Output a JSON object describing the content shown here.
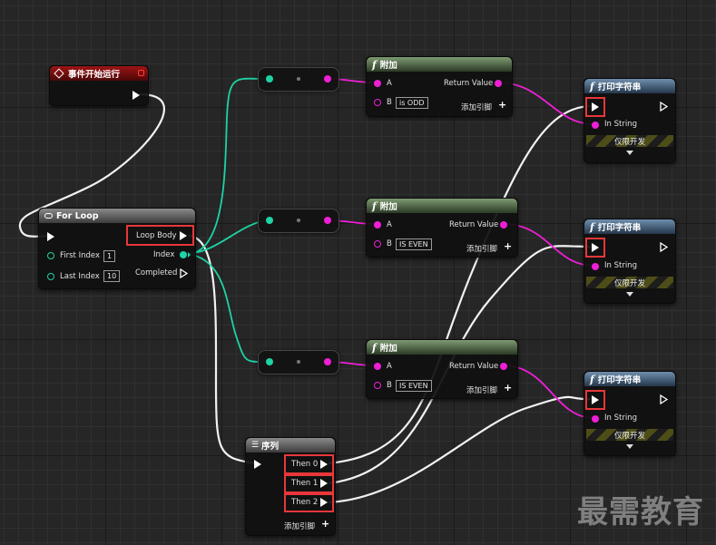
{
  "event_node": {
    "title": "事件开始运行"
  },
  "for_loop": {
    "title": "For Loop",
    "first_index_label": "First Index",
    "first_index_value": "1",
    "last_index_label": "Last Index",
    "last_index_value": "10",
    "loop_body_label": "Loop Body",
    "index_label": "Index",
    "completed_label": "Completed"
  },
  "append_nodes": [
    {
      "title": "附加",
      "a_label": "A",
      "b_label": "B",
      "b_value": "is ODD",
      "return_label": "Return Value",
      "add_pin_label": "添加引脚"
    },
    {
      "title": "附加",
      "a_label": "A",
      "b_label": "B",
      "b_value": "IS EVEN",
      "return_label": "Return Value",
      "add_pin_label": "添加引脚"
    },
    {
      "title": "附加",
      "a_label": "A",
      "b_label": "B",
      "b_value": "IS EVEN",
      "return_label": "Return Value",
      "add_pin_label": "添加引脚"
    }
  ],
  "print_nodes": [
    {
      "title": "打印字符串",
      "in_string_label": "In String",
      "dev_label": "仅限开发"
    },
    {
      "title": "打印字符串",
      "in_string_label": "In String",
      "dev_label": "仅限开发"
    },
    {
      "title": "打印字符串",
      "in_string_label": "In String",
      "dev_label": "仅限开发"
    }
  ],
  "sequence": {
    "title": "序列",
    "then_labels": [
      "Then 0",
      "Then 1",
      "Then 2"
    ],
    "add_pin_label": "添加引脚"
  },
  "watermark": "最需教育",
  "colors": {
    "exec_wire": "#f2f2f2",
    "int_wire": "#1ed3a4",
    "string_wire": "#ee1fd6",
    "highlight": "#e8373a",
    "event_header": "#9e1414",
    "append_header": "#5e7a55",
    "print_header": "#4f6f90"
  }
}
